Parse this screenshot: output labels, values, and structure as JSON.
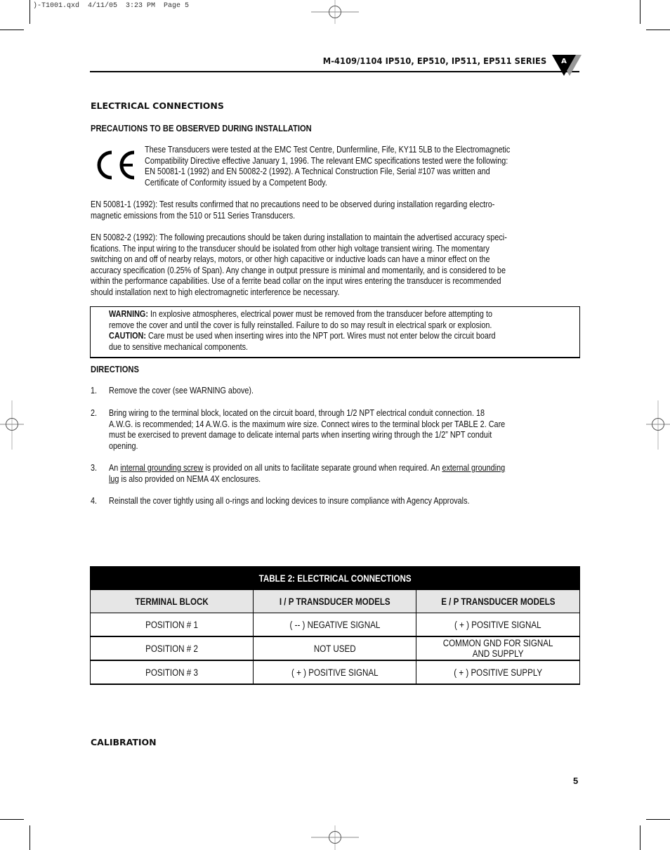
{
  "slug": ")-T1001.qxd  4/11/05  3:23 PM  Page 5",
  "header": {
    "title": "M-4109/1104 IP510, EP510, IP511, EP511 SERIES",
    "badge_letter": "A"
  },
  "section_heading": "ELECTRICAL CONNECTIONS",
  "subheading": "PRECAUTIONS TO BE OBSERVED DURING INSTALLATION",
  "ce_mark": "CE",
  "ce_paragraph_lines": [
    "These Transducers were tested at the EMC Test Centre, Dunfermline, Fife, KY11 5LB to the Electromagnetic",
    "Compatibility Directive effective January 1, 1996. The relevant EMC specifications tested were the following:",
    "EN 50081-1 (1992) and EN 50082-2 (1992). A Technical Construction File, Serial #107 was written and",
    "Certificate of Conformity issued by a Competent Body."
  ],
  "paragraph_en50081_lines": [
    "EN 50081-1 (1992): Test results confirmed that no precautions need to be observed during installation regarding electro-",
    "magnetic emissions from the 510 or 511 Series Transducers."
  ],
  "paragraph_en50082_lines": [
    "EN 50082-2 (1992): The following precautions should be taken during installation to maintain the advertised accuracy speci-",
    "fications. The input wiring to the transducer should be isolated from other high voltage transient wiring. The momentary",
    "switching on and off of nearby relays, motors, or other high capacitive or inductive loads can have a minor effect on the",
    "accuracy specification (0.25% of Span). Any change in output pressure is minimal and momentarily, and is considered to be",
    "within the performance capabilities. Use of a ferrite bead collar on the input wires entering the transducer is recommended",
    "should installation next to high electromagnetic interference be necessary."
  ],
  "warning_box": {
    "warning_label": "WARNING:",
    "warning_line1": " In explosive atmospheres, electrical power must be removed from the transducer before attempting to",
    "warning_line2": "remove the cover and until the cover is fully reinstalled. Failure to do so may result in electrical spark or explosion.",
    "caution_label": "CAUTION:",
    "caution_line1": " Care must be used when inserting wires into the NPT port. Wires must not enter below the circuit board",
    "caution_line2": "due to sensitive mechanical components."
  },
  "directions": {
    "heading": "DIRECTIONS",
    "items": [
      {
        "num": "1.",
        "lines": [
          "Remove the cover (see WARNING above)."
        ]
      },
      {
        "num": "2.",
        "lines": [
          "Bring wiring to the terminal block, located on the circuit board, through 1/2 NPT electrical conduit connection. 18",
          "A.W.G. is recommended; 14 A.W.G. is the maximum wire size. Connect wires to the terminal block per TABLE 2. Care",
          "must be exercised to prevent damage to delicate internal parts when inserting wiring through the 1/2” NPT conduit",
          "opening."
        ]
      },
      {
        "num": "3.",
        "part1": "An ",
        "link1": "internal grounding screw",
        "part2": " is provided on all units to facilitate separate ground when required. An ",
        "link2a": "external grounding",
        "link2b": "lug",
        "part3": " is also provided on NEMA 4X enclosures."
      },
      {
        "num": "4.",
        "lines": [
          "Reinstall the cover tightly using all o-rings and locking devices to insure compliance with Agency Approvals."
        ]
      }
    ]
  },
  "table2": {
    "caption": "TABLE 2: ELECTRICAL CONNECTIONS",
    "headers": [
      "TERMINAL BLOCK",
      "I / P TRANSDUCER MODELS",
      "E / P TRANSDUCER MODELS"
    ],
    "rows": [
      [
        "POSITION # 1",
        "( -- ) NEGATIVE SIGNAL",
        "( + ) POSITIVE SIGNAL"
      ],
      [
        "POSITION # 2",
        "NOT USED",
        "COMMON GND FOR SIGNAL",
        "AND SUPPLY"
      ],
      [
        "POSITION # 3",
        "( + ) POSITIVE SIGNAL",
        "( + ) POSITIVE SUPPLY"
      ]
    ]
  },
  "calibration_heading": "CALIBRATION",
  "page_number": "5"
}
